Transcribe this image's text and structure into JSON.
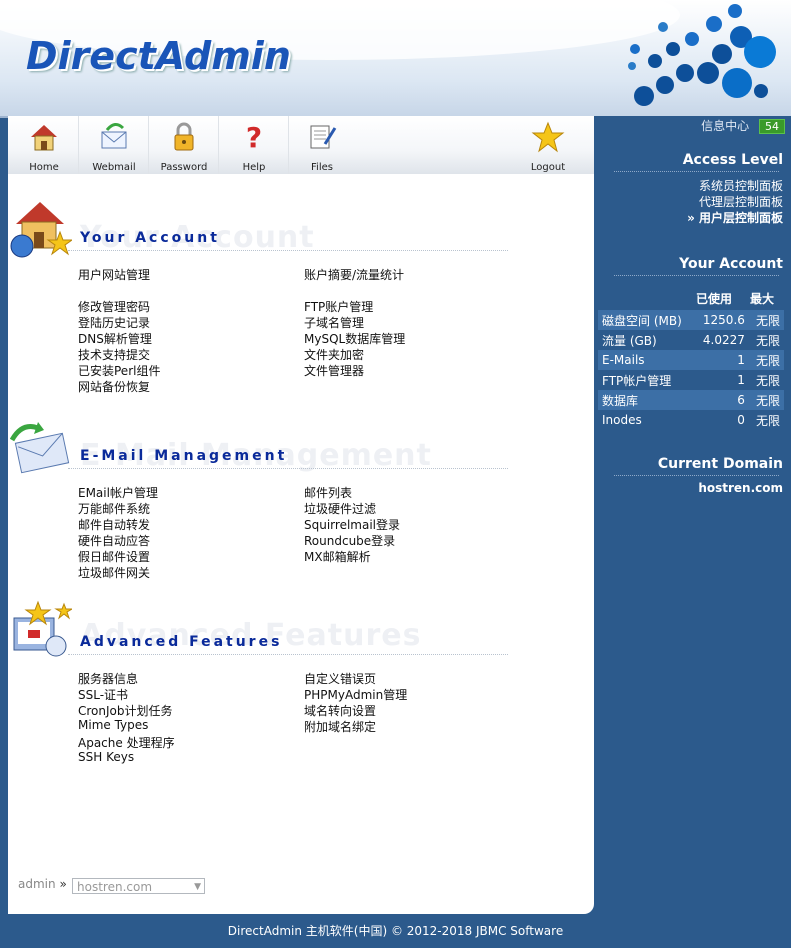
{
  "brand": {
    "logo_text": "DirectAdmin"
  },
  "toolbar": {
    "items": [
      {
        "label": "Home",
        "icon": "house-icon"
      },
      {
        "label": "Webmail",
        "icon": "mail-icon"
      },
      {
        "label": "Password",
        "icon": "padlock-icon"
      },
      {
        "label": "Help",
        "icon": "question-icon"
      },
      {
        "label": "Files",
        "icon": "folder-files-icon"
      }
    ],
    "logout": {
      "label": "Logout",
      "icon": "star-icon"
    }
  },
  "sections": {
    "account": {
      "title": "Your Account",
      "left": [
        "用户网站管理",
        "",
        "修改管理密码",
        "登陆历史记录",
        "DNS解析管理",
        "技术支持提交",
        "已安装Perl组件",
        "网站备份恢复"
      ],
      "right": [
        "账户摘要/流量统计",
        "",
        "FTP账户管理",
        "子域名管理",
        "MySQL数据库管理",
        "文件夹加密",
        "文件管理器"
      ]
    },
    "email": {
      "title": "E-Mail Management",
      "left": [
        "EMail帐户管理",
        "万能邮件系统",
        "邮件自动转发",
        "硬件自动应答",
        "假日邮件设置",
        "垃圾邮件网关"
      ],
      "right": [
        "邮件列表",
        "垃圾硬件过滤",
        "Squirrelmail登录",
        "Roundcube登录",
        "MX邮箱解析"
      ]
    },
    "advanced": {
      "title": "Advanced Features",
      "left": [
        "服务器信息",
        "SSL-证书",
        "CronJob计划任务",
        "Mime Types",
        "Apache 处理程序",
        "SSH Keys"
      ],
      "right": [
        "自定义错误页",
        "PHPMyAdmin管理",
        "域名转向设置",
        "附加域名绑定"
      ]
    }
  },
  "sidebar": {
    "info_center": "信息中心",
    "info_count": "54",
    "access_level": {
      "heading": "Access Level",
      "items": [
        "系统员控制面板",
        "代理层控制面板",
        "» 用户层控制面板"
      ]
    },
    "your_account": {
      "heading": "Your Account",
      "col_used": "已使用",
      "col_max": "最大",
      "rows": [
        {
          "label": "磁盘空间 (MB)",
          "used": "1250.6",
          "max": "无限"
        },
        {
          "label": "流量 (GB)",
          "used": "4.0227",
          "max": "无限"
        },
        {
          "label": "E-Mails",
          "used": "1",
          "max": "无限"
        },
        {
          "label": "FTP帐户管理",
          "used": "1",
          "max": "无限"
        },
        {
          "label": "数据库",
          "used": "6",
          "max": "无限"
        },
        {
          "label": "Inodes",
          "used": "0",
          "max": "无限"
        }
      ]
    },
    "current_domain": {
      "heading": "Current Domain",
      "domain": "hostren.com"
    }
  },
  "breadcrumb": {
    "user": "admin",
    "separator": "»",
    "selected_domain": "hostren.com"
  },
  "footer": {
    "text": "DirectAdmin 主机软件(中国) © 2012-2018 JBMC Software"
  },
  "colors": {
    "accent_blue": "#1a55b8",
    "sidebar_bg": "#2c5a8c",
    "badge_green": "#3a9a2a"
  }
}
